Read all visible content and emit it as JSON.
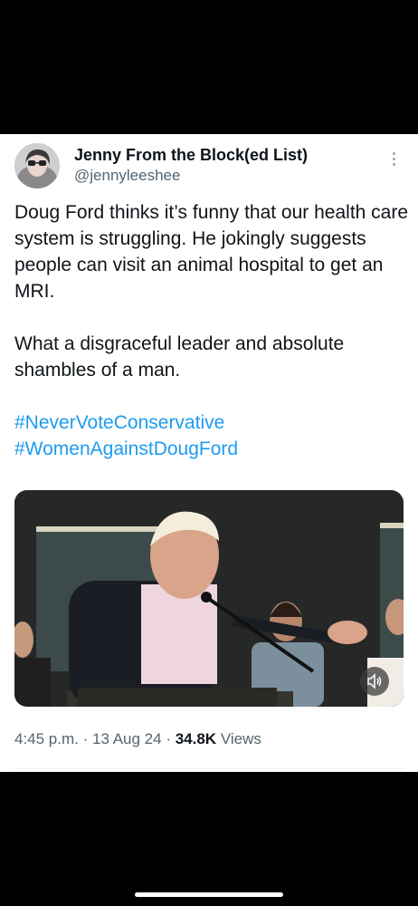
{
  "tweet": {
    "author_name": "Jenny From the Block(ed List)",
    "author_handle": "@jennyleeshee",
    "paragraph_1": "Doug Ford thinks it’s funny that our health care system is struggling. He jokingly suggests people can visit an animal hospital to get an MRI.",
    "paragraph_2": "What a disgraceful leader and absolute shambles of a man.",
    "hashtags": [
      "#NeverVoteConservative",
      "#WomenAgainstDougFord"
    ],
    "time": "4:45 p.m.",
    "date": "13 Aug 24",
    "views_count": "34.8K",
    "views_label": "Views"
  },
  "icons": {
    "more": "more-vertical-icon",
    "sound": "speaker-icon"
  },
  "colors": {
    "hashtag": "#1d9bf0",
    "text": "#0f1419",
    "secondary": "#536471"
  }
}
